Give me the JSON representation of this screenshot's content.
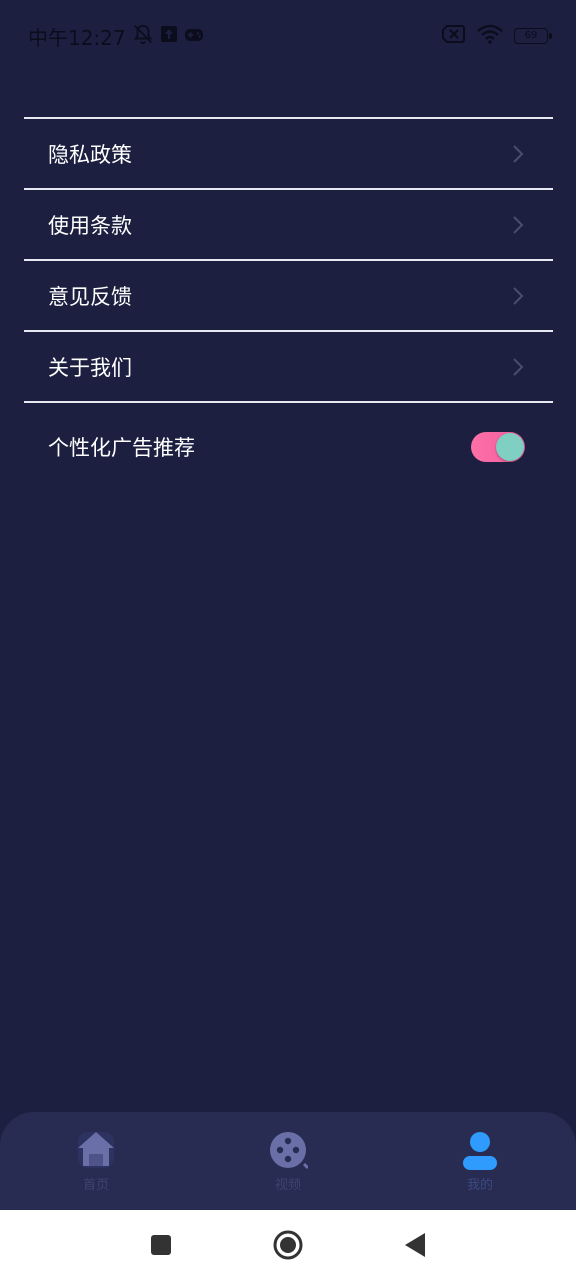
{
  "status_bar": {
    "time": "中午12:27",
    "battery_level": "69",
    "icons_left": [
      "bell-off-icon",
      "upload-icon",
      "gamepad-icon"
    ],
    "icons_right": [
      "sim-error-icon",
      "wifi-icon",
      "battery-icon"
    ]
  },
  "settings": {
    "items": [
      {
        "label": "隐私政策",
        "icon": "chevron-right-icon"
      },
      {
        "label": "使用条款",
        "icon": "chevron-right-icon"
      },
      {
        "label": "意见反馈",
        "icon": "chevron-right-icon"
      },
      {
        "label": "关于我们",
        "icon": "chevron-right-icon"
      }
    ],
    "ad_toggle": {
      "label": "个性化广告推荐",
      "enabled": true
    }
  },
  "bottom_nav": {
    "items": [
      {
        "label": "首页",
        "icon": "home-icon"
      },
      {
        "label": "视频",
        "icon": "film-reel-icon"
      },
      {
        "label": "我的",
        "icon": "user-icon",
        "active": true
      }
    ]
  },
  "colors": {
    "background": "#1c1f40",
    "nav_background": "#282c53",
    "toggle_track": "#ee5f9e",
    "toggle_knob": "#7fcfc2",
    "active_icon": "#2f9bff"
  }
}
